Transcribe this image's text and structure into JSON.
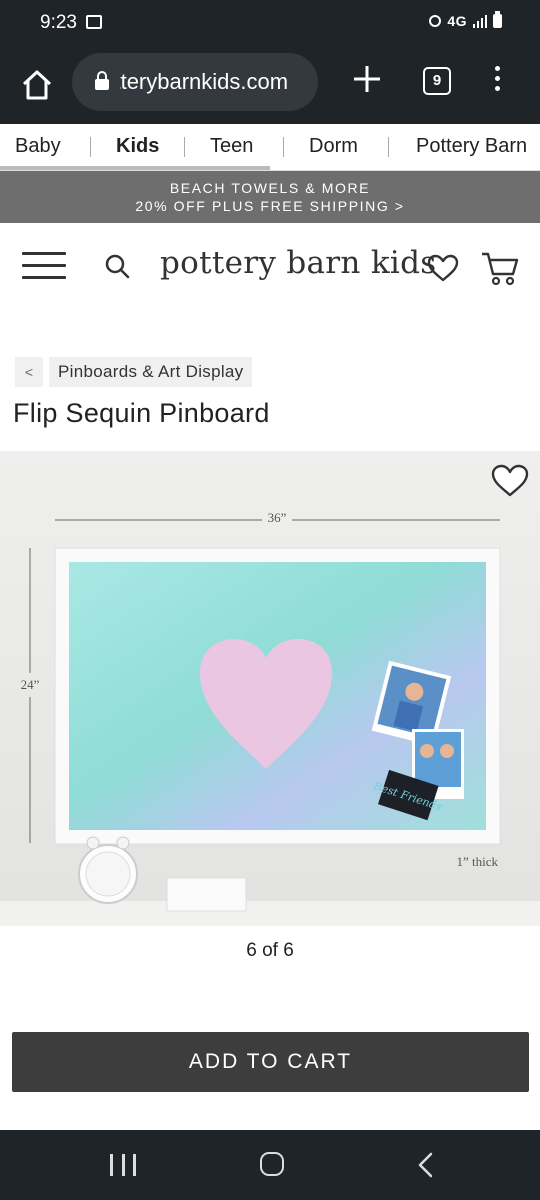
{
  "status_bar": {
    "time": "9:23",
    "network": "4G"
  },
  "browser": {
    "url": "potterybarnkids.com",
    "tab_count": "9"
  },
  "category_nav": [
    "Baby",
    "Kids",
    "Teen",
    "Dorm",
    "Pottery Barn"
  ],
  "promo": {
    "line1": "BEACH TOWELS & MORE",
    "line2": "20% OFF PLUS FREE SHIPPING >"
  },
  "header": {
    "logo": "pottery barn kids"
  },
  "breadcrumb": {
    "back": "<",
    "link": "Pinboards & Art Display"
  },
  "product": {
    "title": "Flip Sequin Pinboard",
    "image": {
      "width_label": "36”",
      "height_label": "24”",
      "depth_label": "1” thick",
      "photo_caption": "Best Friends"
    },
    "image_counter": "6 of 6",
    "add_to_cart": "ADD TO CART"
  }
}
